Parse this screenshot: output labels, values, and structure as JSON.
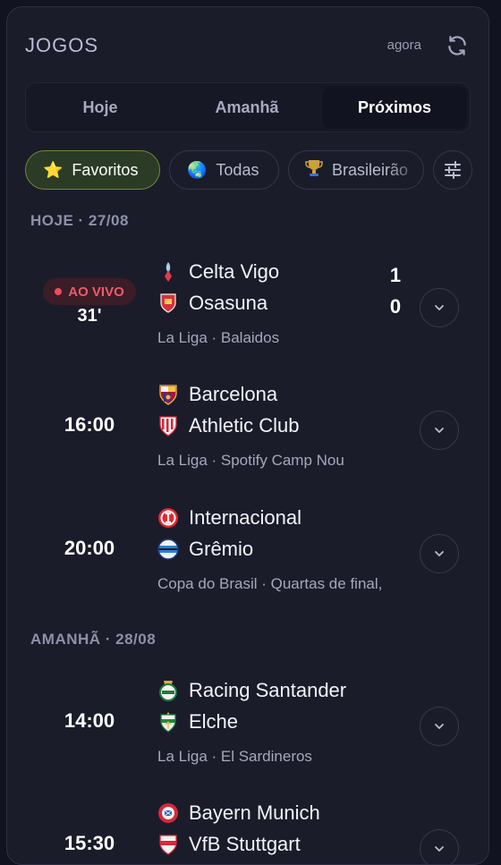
{
  "header": {
    "title": "JOGOS",
    "updated": "agora"
  },
  "tabs": [
    {
      "label": "Hoje"
    },
    {
      "label": "Amanhã"
    },
    {
      "label": "Próximos",
      "active": true
    }
  ],
  "filters": [
    {
      "label": "Favoritos",
      "icon": "⭐",
      "active": true
    },
    {
      "label": "Todas",
      "icon": "🌏"
    },
    {
      "label": "Brasileirão",
      "icon": "trophy-icon"
    }
  ],
  "sections": [
    {
      "label": "HOJE · 27/08",
      "matches": [
        {
          "status": "live",
          "live_label": "AO VIVO",
          "minute": "31'",
          "home": {
            "name": "Celta Vigo",
            "score": "1"
          },
          "away": {
            "name": "Osasuna",
            "score": "0"
          },
          "meta": "La Liga · Balaidos"
        },
        {
          "time": "16:00",
          "home": {
            "name": "Barcelona"
          },
          "away": {
            "name": "Athletic Club"
          },
          "meta": "La Liga · Spotify Camp Nou"
        },
        {
          "time": "20:00",
          "home": {
            "name": "Internacional"
          },
          "away": {
            "name": "Grêmio"
          },
          "meta": "Copa do Brasil · Quartas de final,"
        }
      ]
    },
    {
      "label": "AMANHÃ · 28/08",
      "matches": [
        {
          "time": "14:00",
          "home": {
            "name": "Racing Santander"
          },
          "away": {
            "name": "Elche"
          },
          "meta": "La Liga · El Sardineros"
        },
        {
          "time": "15:30",
          "home": {
            "name": "Bayern Munich"
          },
          "away": {
            "name": "VfB Stuttgart"
          },
          "meta": ""
        }
      ]
    }
  ],
  "colors": {
    "background": "#121320",
    "panel": "#1b1c2a",
    "live": "#ef5a6a",
    "favorite_chip": "#2b3b25"
  }
}
